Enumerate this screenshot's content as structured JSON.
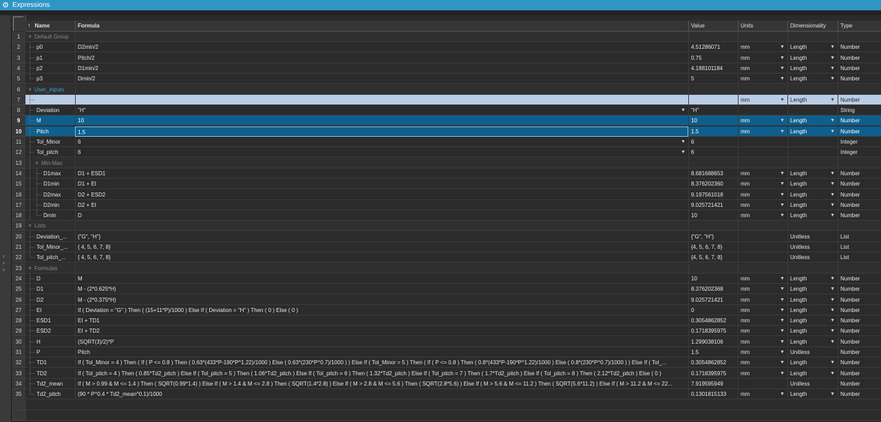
{
  "window": {
    "title": "Expressions"
  },
  "columns": {
    "name": "Name",
    "formula": "Formula",
    "value": "Value",
    "units": "Units",
    "dimensionality": "Dimensionality",
    "type": "Type"
  },
  "sidebar_arrows": "> > >",
  "rows": [
    {
      "n": "1",
      "kind": "group",
      "level": 0,
      "name": "Default Group",
      "formula": "",
      "value": "",
      "units": "",
      "dim": "",
      "type": "",
      "blue": false
    },
    {
      "n": "2",
      "kind": "param",
      "level": 1,
      "name": "p0",
      "formula": "D2min/2",
      "value": "4.51286071",
      "units": "mm",
      "dim": "Length",
      "type": "Number"
    },
    {
      "n": "3",
      "kind": "param",
      "level": 1,
      "name": "p1",
      "formula": "Pitch/2",
      "value": "0.75",
      "units": "mm",
      "dim": "Length",
      "type": "Number"
    },
    {
      "n": "4",
      "kind": "param",
      "level": 1,
      "name": "p2",
      "formula": "D1min/2",
      "value": "4.188101184",
      "units": "mm",
      "dim": "Length",
      "type": "Number"
    },
    {
      "n": "5",
      "kind": "param",
      "level": 1,
      "name": "p3",
      "formula": "Dmin/2",
      "value": "5",
      "units": "mm",
      "dim": "Length",
      "type": "Number",
      "last": true
    },
    {
      "n": "6",
      "kind": "group",
      "level": 0,
      "name": "User_Inputs",
      "formula": "",
      "value": "",
      "units": "",
      "dim": "",
      "type": "",
      "blue": true
    },
    {
      "n": "7",
      "kind": "edit",
      "level": 1,
      "name": "",
      "formula": "",
      "value": "",
      "units": "mm",
      "dim": "Length",
      "type": "Number"
    },
    {
      "n": "8",
      "kind": "param",
      "level": 1,
      "name": "Deviation",
      "formula": "\"H\"",
      "value": "\"H\"",
      "units": "",
      "dim": "",
      "type": "String",
      "formula_dd": true
    },
    {
      "n": "9",
      "kind": "selected",
      "level": 1,
      "name": "M",
      "formula": "10",
      "value": "10",
      "units": "mm",
      "dim": "Length",
      "type": "Number"
    },
    {
      "n": "10",
      "kind": "selected",
      "level": 1,
      "name": "Pitch",
      "formula": "1.5",
      "value": "1.5",
      "units": "mm",
      "dim": "Length",
      "type": "Number",
      "sel_formula": true
    },
    {
      "n": "11",
      "kind": "param",
      "level": 1,
      "name": "Tol_Minor",
      "formula": "6",
      "value": "6",
      "units": "",
      "dim": "",
      "type": "Integer",
      "formula_dd": true
    },
    {
      "n": "12",
      "kind": "param",
      "level": 1,
      "name": "Tol_pitch",
      "formula": "6",
      "value": "6",
      "units": "",
      "dim": "",
      "type": "Integer",
      "formula_dd": true
    },
    {
      "n": "13",
      "kind": "group",
      "level": 1,
      "name": "Min-Max",
      "formula": "",
      "value": "",
      "units": "",
      "dim": "",
      "type": "",
      "blue": false
    },
    {
      "n": "14",
      "kind": "param",
      "level": 2,
      "name": "D1max",
      "formula": "D1 + ESD1",
      "value": "8.681688653",
      "units": "mm",
      "dim": "Length",
      "type": "Number"
    },
    {
      "n": "15",
      "kind": "param",
      "level": 2,
      "name": "D1min",
      "formula": "D1 + EI",
      "value": "8.376202360",
      "units": "mm",
      "dim": "Length",
      "type": "Number"
    },
    {
      "n": "16",
      "kind": "param",
      "level": 2,
      "name": "D2max",
      "formula": "D2 + ESD2",
      "value": "9.197561018",
      "units": "mm",
      "dim": "Length",
      "type": "Number"
    },
    {
      "n": "17",
      "kind": "param",
      "level": 2,
      "name": "D2min",
      "formula": "D2 + EI",
      "value": "9.025721421",
      "units": "mm",
      "dim": "Length",
      "type": "Number"
    },
    {
      "n": "18",
      "kind": "param",
      "level": 2,
      "name": "Dmin",
      "formula": "D",
      "value": "10",
      "units": "mm",
      "dim": "Length",
      "type": "Number",
      "last": true
    },
    {
      "n": "19",
      "kind": "group",
      "level": 0,
      "name": "Lists",
      "formula": "",
      "value": "",
      "units": "",
      "dim": "",
      "type": "",
      "blue": false
    },
    {
      "n": "20",
      "kind": "param",
      "level": 1,
      "name": "Deviation_...",
      "formula": "{\"G\", \"H\"}",
      "value": "{\"G\", \"H\"}",
      "units": "",
      "dim": "Unitless",
      "type": "List"
    },
    {
      "n": "21",
      "kind": "param",
      "level": 1,
      "name": "Tol_Minor_...",
      "formula": "{ 4, 5, 6, 7, 8}",
      "value": "{4, 5, 6, 7, 8}",
      "units": "",
      "dim": "Unitless",
      "type": "List"
    },
    {
      "n": "22",
      "kind": "param",
      "level": 1,
      "name": "Tol_pitch_...",
      "formula": "{ 4, 5, 6, 7, 8}",
      "value": "{4, 5, 6, 7, 8}",
      "units": "",
      "dim": "Unitless",
      "type": "List",
      "last": true
    },
    {
      "n": "23",
      "kind": "group",
      "level": 0,
      "name": "Formulas",
      "formula": "",
      "value": "",
      "units": "",
      "dim": "",
      "type": "",
      "blue": false
    },
    {
      "n": "24",
      "kind": "param",
      "level": 1,
      "name": "D",
      "formula": "M",
      "value": "10",
      "units": "mm",
      "dim": "Length",
      "type": "Number"
    },
    {
      "n": "25",
      "kind": "param",
      "level": 1,
      "name": "D1",
      "formula": "M - (2*0.625*H)",
      "value": "8.376202368",
      "units": "mm",
      "dim": "Length",
      "type": "Number"
    },
    {
      "n": "26",
      "kind": "param",
      "level": 1,
      "name": "D2",
      "formula": "M - (2*0.375*H)",
      "value": "9.025721421",
      "units": "mm",
      "dim": "Length",
      "type": "Number"
    },
    {
      "n": "27",
      "kind": "param",
      "level": 1,
      "name": "EI",
      "formula": "If ( Deviation = \"G\" ) Then ( (15+11*P)/1000 ) Else If ( Deviation = \"H\" ) Then ( 0 ) Else ( 0 )",
      "value": "0",
      "units": "mm",
      "dim": "Length",
      "type": "Number"
    },
    {
      "n": "28",
      "kind": "param",
      "level": 1,
      "name": "ESD1",
      "formula": "EI + TD1",
      "value": "0.3054862852",
      "units": "mm",
      "dim": "Length",
      "type": "Number"
    },
    {
      "n": "29",
      "kind": "param",
      "level": 1,
      "name": "ESD2",
      "formula": "EI + TD2",
      "value": "0.1718395975",
      "units": "mm",
      "dim": "Length",
      "type": "Number"
    },
    {
      "n": "30",
      "kind": "param",
      "level": 1,
      "name": "H",
      "formula": "(SQRT(3)/2)*P",
      "value": "1.299038106",
      "units": "mm",
      "dim": "Length",
      "type": "Number"
    },
    {
      "n": "31",
      "kind": "param",
      "level": 1,
      "name": "P",
      "formula": "Pitch",
      "value": "1.5",
      "units": "mm",
      "dim": "Unitless",
      "type": "Number"
    },
    {
      "n": "32",
      "kind": "param",
      "level": 1,
      "name": "TD1",
      "formula": "If ( Tol_Minor = 4 ) Then ( If ( P <= 0.8 ) Then ( 0.63*(433*P-190*P^1.22)/1000 ) Else ( 0.63*(230*P^0.7)/1000 ) ) Else If ( Tol_Minor = 5 ) Then ( If ( P <= 0.8 ) Then ( 0.8*(433*P-190*P^1.22)/1000 ) Else ( 0.8*(230*P^0.7)/1000 ) ) Else If ( Tol_...",
      "value": "0.3054862852",
      "units": "mm",
      "dim": "Length",
      "type": "Number"
    },
    {
      "n": "33",
      "kind": "param",
      "level": 1,
      "name": "TD2",
      "formula": "If ( Tol_pitch = 4 ) Then ( 0.85*Td2_pitch ) Else If ( Tol_pitch = 5 ) Then ( 1.06*Td2_pitch ) Else If ( Tol_pitch = 6 ) Then ( 1.32*Td2_pitch ) Else If ( Tol_pitch = 7 ) Then ( 1.7*Td2_pitch ) Else If ( Tol_pitch = 8 ) Then ( 2.12*Td2_pitch ) Else ( 0 )",
      "value": "0.1718395975",
      "units": "mm",
      "dim": "Length",
      "type": "Number"
    },
    {
      "n": "34",
      "kind": "param",
      "level": 1,
      "name": "Td2_mean",
      "formula": "If ( M > 0.99 & M <= 1.4 ) Then ( SQRT(0.99*1.4) ) Else If ( M > 1.4 & M <= 2.8 ) Then ( SQRT(1.4*2.8) ) Else If ( M > 2.8 & M <= 5.6 ) Then ( SQRT(2.8*5.6) ) Else If ( M > 5.6 & M <= 11.2 ) Then ( SQRT(5.6*11.2) ) Else If ( M > 11.2 & M <= 22...",
      "value": "7.919595949",
      "units": "",
      "dim": "Unitless",
      "type": "Number"
    },
    {
      "n": "35",
      "kind": "param",
      "level": 1,
      "name": "Td2_pitch",
      "formula": "(90 * P^0.4 * Td2_mean^0.1)/1000",
      "value": "0.1301815133",
      "units": "mm",
      "dim": "Length",
      "type": "Number",
      "last": true
    }
  ]
}
